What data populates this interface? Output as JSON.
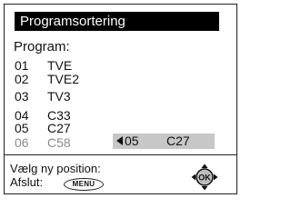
{
  "title": "Programsortering",
  "program_label": "Program:",
  "programs": [
    {
      "num": "01",
      "name": "TVE"
    },
    {
      "num": "02",
      "name": "TVE2"
    },
    {
      "num": "03",
      "name": "TV3"
    },
    {
      "num": "04",
      "name": "C33"
    },
    {
      "num": "05",
      "name": "C27"
    },
    {
      "num": "06",
      "name": "C58",
      "dimmed": true
    }
  ],
  "moving": {
    "num": "05",
    "name": "C27",
    "icon": "left-arrow-icon"
  },
  "footer": {
    "hint_position": "Vælg ny position:",
    "hint_exit": "Afslut:",
    "menu_key_label": "MENU",
    "ok_key_label": "OK"
  },
  "colors": {
    "title_bg": "#000000",
    "title_fg": "#ffffff",
    "highlight_bg": "#c7c7c7",
    "dim_text": "#8a8a8a"
  }
}
